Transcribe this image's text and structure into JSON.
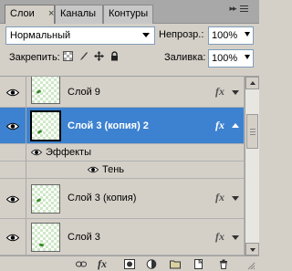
{
  "tabs": [
    {
      "label": "Слои",
      "active": true
    },
    {
      "label": "Каналы",
      "active": false
    },
    {
      "label": "Контуры",
      "active": false
    }
  ],
  "tab_close_glyph": "×",
  "panel_menu_glyph": "▸▸",
  "blend_mode": {
    "value": "Нормальный"
  },
  "opacity": {
    "label": "Непрозр.:",
    "value": "100%"
  },
  "lock": {
    "label": "Закрепить:",
    "icons": [
      "lock-transparency-icon",
      "lock-paint-icon",
      "lock-move-icon",
      "lock-all-icon"
    ]
  },
  "fill": {
    "label": "Заливка:",
    "value": "100%"
  },
  "layers": [
    {
      "name": "Слой 9",
      "selected": false,
      "visible": true,
      "fx": true
    },
    {
      "name": "Слой 3 (копия) 2",
      "selected": true,
      "visible": true,
      "fx": true,
      "effects_expanded": true
    },
    {
      "name": "Слой 3 (копия)",
      "selected": false,
      "visible": true,
      "fx": true
    },
    {
      "name": "Слой 3",
      "selected": false,
      "visible": true,
      "fx": true
    }
  ],
  "effects": {
    "header": "Эффекты",
    "items": [
      {
        "name": "Тень",
        "visible": true
      }
    ]
  },
  "fx_label": "fx",
  "bottom_icons": [
    "link-layers-icon",
    "add-style-icon",
    "add-mask-icon",
    "adjustment-layer-icon",
    "new-group-icon",
    "new-layer-icon",
    "delete-layer-icon"
  ],
  "colors": {
    "selection": "#3d82d0",
    "panel": "#d4d0c8",
    "tab_bar": "#a8a8a8",
    "leaf": "#3a8a2a"
  }
}
